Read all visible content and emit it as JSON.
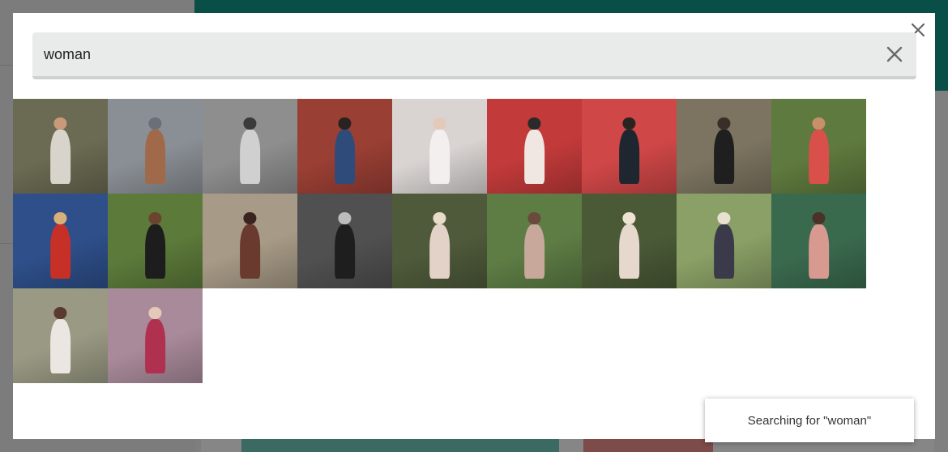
{
  "search": {
    "value": "woman",
    "placeholder": ""
  },
  "modal": {
    "close_icon": "close-icon",
    "clear_icon": "clear-search-icon"
  },
  "results": [
    {
      "alt": "woman in floral dress",
      "bg": "#6b6a52",
      "accent": "#d8d4cc",
      "head": "#c89a7a"
    },
    {
      "alt": "tattooed forearm",
      "bg": "#8a8f95",
      "accent": "#a06a4a",
      "head": "#6b7078"
    },
    {
      "alt": "street performers black and white",
      "bg": "#8e8e8e",
      "accent": "#d0d0d0",
      "head": "#3a3a3a"
    },
    {
      "alt": "woman walking by red wall",
      "bg": "#9a3f34",
      "accent": "#2f4b7a",
      "head": "#2a2220"
    },
    {
      "alt": "woman lying portrait",
      "bg": "#d9d4d2",
      "accent": "#f2efee",
      "head": "#e5c9b8"
    },
    {
      "alt": "woman with red mascots",
      "bg": "#c23a3a",
      "accent": "#f0e6e2",
      "head": "#2a2a2a"
    },
    {
      "alt": "woman with red mascot",
      "bg": "#d04747",
      "accent": "#1e2630",
      "head": "#2a2420"
    },
    {
      "alt": "woman in black dress old room",
      "bg": "#7c7460",
      "accent": "#1f1f1f",
      "head": "#3a2e28"
    },
    {
      "alt": "woman smiling portrait",
      "bg": "#5f7a3e",
      "accent": "#d9504a",
      "head": "#c98f6a"
    },
    {
      "alt": "woman in red dress",
      "bg": "#2e4f8a",
      "accent": "#c63027",
      "head": "#d8b07a"
    },
    {
      "alt": "woman in black with motorcycle helmet",
      "bg": "#5c7a3a",
      "accent": "#1d1d1d",
      "head": "#6b4430"
    },
    {
      "alt": "woman by graffiti wall",
      "bg": "#a79a86",
      "accent": "#6a3a2e",
      "head": "#3a2420"
    },
    {
      "alt": "man on motorbike black and white",
      "bg": "#505050",
      "accent": "#1e1e1e",
      "head": "#bcbcbc"
    },
    {
      "alt": "woman in forest bridge",
      "bg": "#4e5a3a",
      "accent": "#e2d2c8",
      "head": "#e8dcc8"
    },
    {
      "alt": "woman sitting in green forest",
      "bg": "#5e7d45",
      "accent": "#c8a89a",
      "head": "#6a4a3a"
    },
    {
      "alt": "woman on wooden bridge forest",
      "bg": "#4a5a36",
      "accent": "#e6d8cc",
      "head": "#efe4d4"
    },
    {
      "alt": "woman sitting on grass",
      "bg": "#8aa066",
      "accent": "#3a3a4a",
      "head": "#e8e0d0"
    },
    {
      "alt": "woman hands on face portrait",
      "bg": "#3a6a4e",
      "accent": "#d89a90",
      "head": "#4a3228"
    },
    {
      "alt": "woman in white lace",
      "bg": "#9a9a84",
      "accent": "#ece6e2",
      "head": "#5a3a2e"
    },
    {
      "alt": "virtual woman in pink room",
      "bg": "#a98a9a",
      "accent": "#b03050",
      "head": "#e4c8b8"
    }
  ],
  "toast": {
    "text": "Searching for \"woman\""
  }
}
